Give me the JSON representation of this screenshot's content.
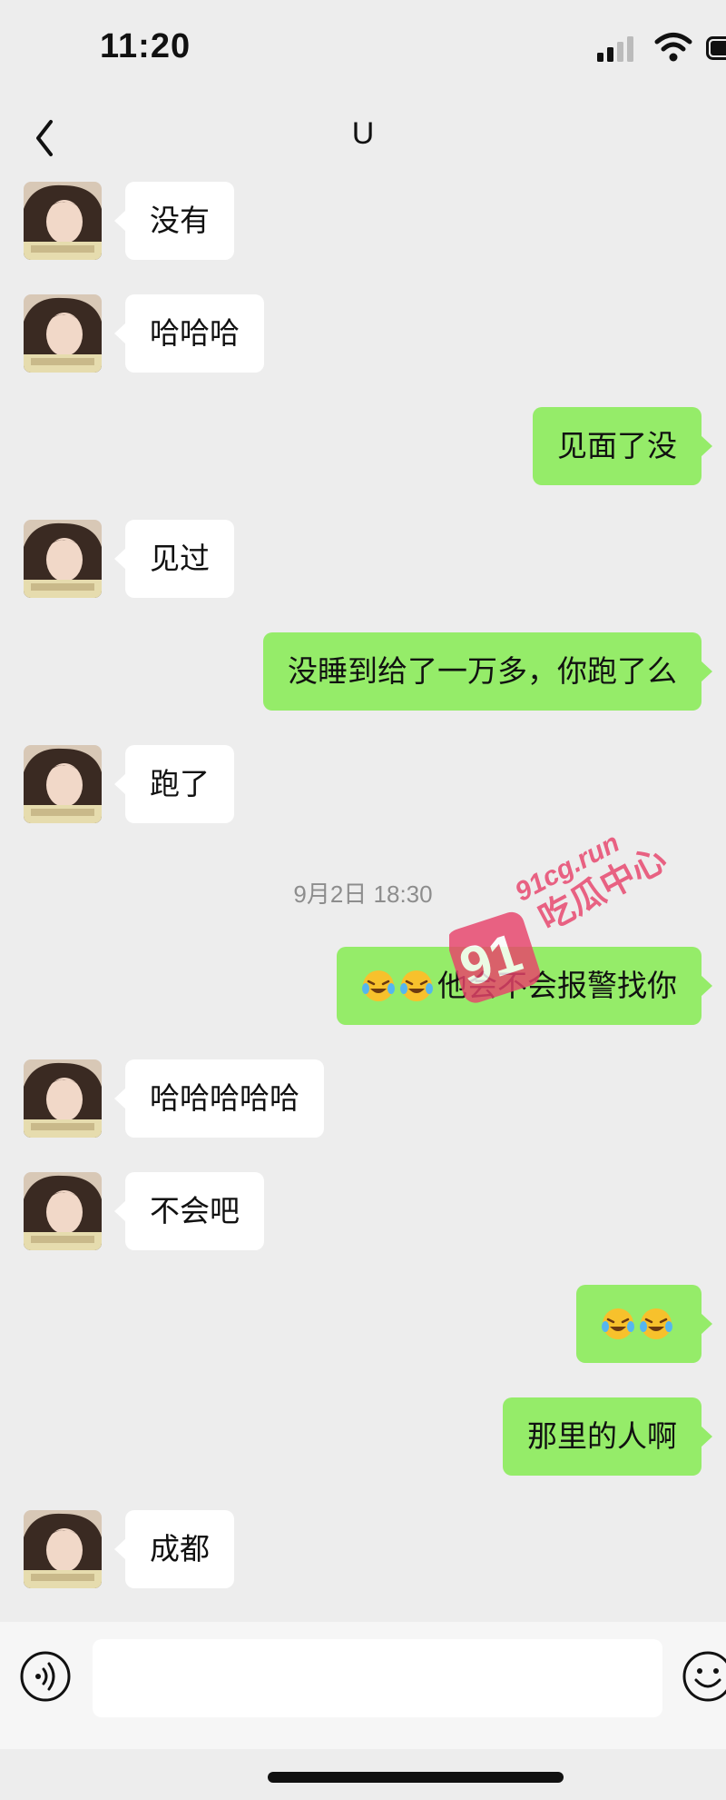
{
  "status_bar": {
    "time": "11:20"
  },
  "header": {
    "title": "U"
  },
  "messages": [
    {
      "side": "in",
      "text": "没有"
    },
    {
      "side": "in",
      "text": "哈哈哈"
    },
    {
      "side": "out",
      "text": "见面了没"
    },
    {
      "side": "in",
      "text": "见过"
    },
    {
      "side": "out",
      "text": "没睡到给了一万多，你跑了么"
    },
    {
      "side": "in",
      "text": "跑了"
    },
    {
      "timestamp": "9月2日 18:30"
    },
    {
      "side": "out",
      "emojis": [
        "laughing-crying-emoji",
        "laughing-crying-emoji"
      ],
      "text": "他会不会报警找你"
    },
    {
      "side": "in",
      "text": "哈哈哈哈哈"
    },
    {
      "side": "in",
      "text": "不会吧"
    },
    {
      "side": "out",
      "emojis": [
        "laughing-crying-emoji",
        "laughing-crying-emoji"
      ],
      "text": ""
    },
    {
      "side": "out",
      "text": "那里的人啊"
    },
    {
      "side": "in",
      "text": "成都"
    }
  ],
  "watermark": {
    "url": "91cg.run",
    "brand": "吃瓜中心",
    "number": "91"
  },
  "input_bar": {
    "message_value": ""
  },
  "colors": {
    "background": "#ededed",
    "incoming_bubble": "#ffffff",
    "outgoing_bubble": "#95ec69",
    "watermark": "#e8436b"
  }
}
